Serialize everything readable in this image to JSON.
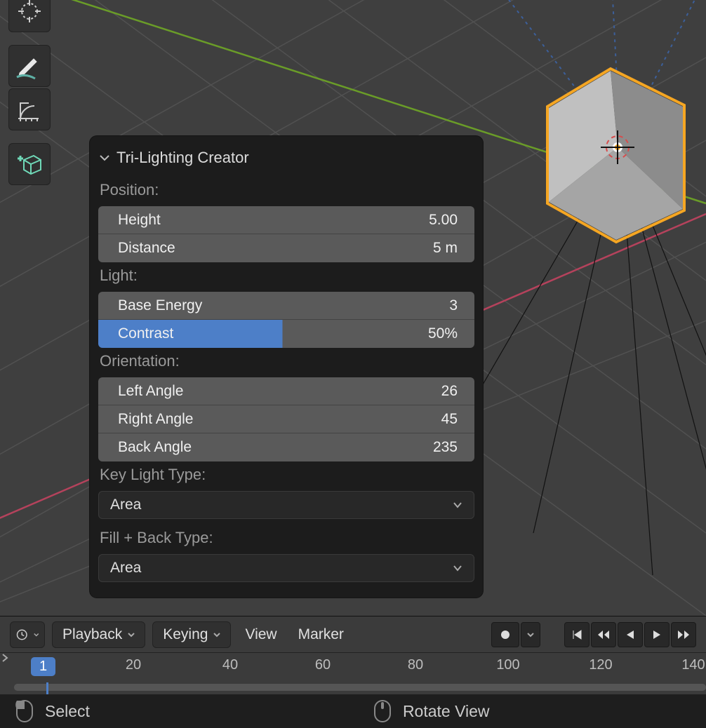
{
  "panel": {
    "title": "Tri-Lighting Creator",
    "sections": {
      "position": {
        "label": "Position:",
        "height_lbl": "Height",
        "height_val": "5.00",
        "distance_lbl": "Distance",
        "distance_val": "5 m"
      },
      "light": {
        "label": "Light:",
        "base_lbl": "Base Energy",
        "base_val": "3",
        "contrast_lbl": "Contrast",
        "contrast_val": "50%"
      },
      "orientation": {
        "label": "Orientation:",
        "left_lbl": "Left Angle",
        "left_val": "26",
        "right_lbl": "Right Angle",
        "right_val": "45",
        "back_lbl": "Back Angle",
        "back_val": "235"
      },
      "key_type": {
        "label": "Key Light Type:",
        "value": "Area"
      },
      "fill_type": {
        "label": "Fill + Back Type:",
        "value": "Area"
      }
    }
  },
  "timeline": {
    "playback": "Playback",
    "keying": "Keying",
    "view": "View",
    "marker": "Marker",
    "current_frame": "1",
    "ticks": [
      "20",
      "40",
      "60",
      "80",
      "100",
      "120",
      "140"
    ]
  },
  "status": {
    "left": "Select",
    "right": "Rotate View"
  },
  "colors": {
    "highlight": "#4d7fc8",
    "cube_outline": "#f5a623",
    "axis_green": "#6a9c28",
    "axis_red": "#b5425c"
  }
}
